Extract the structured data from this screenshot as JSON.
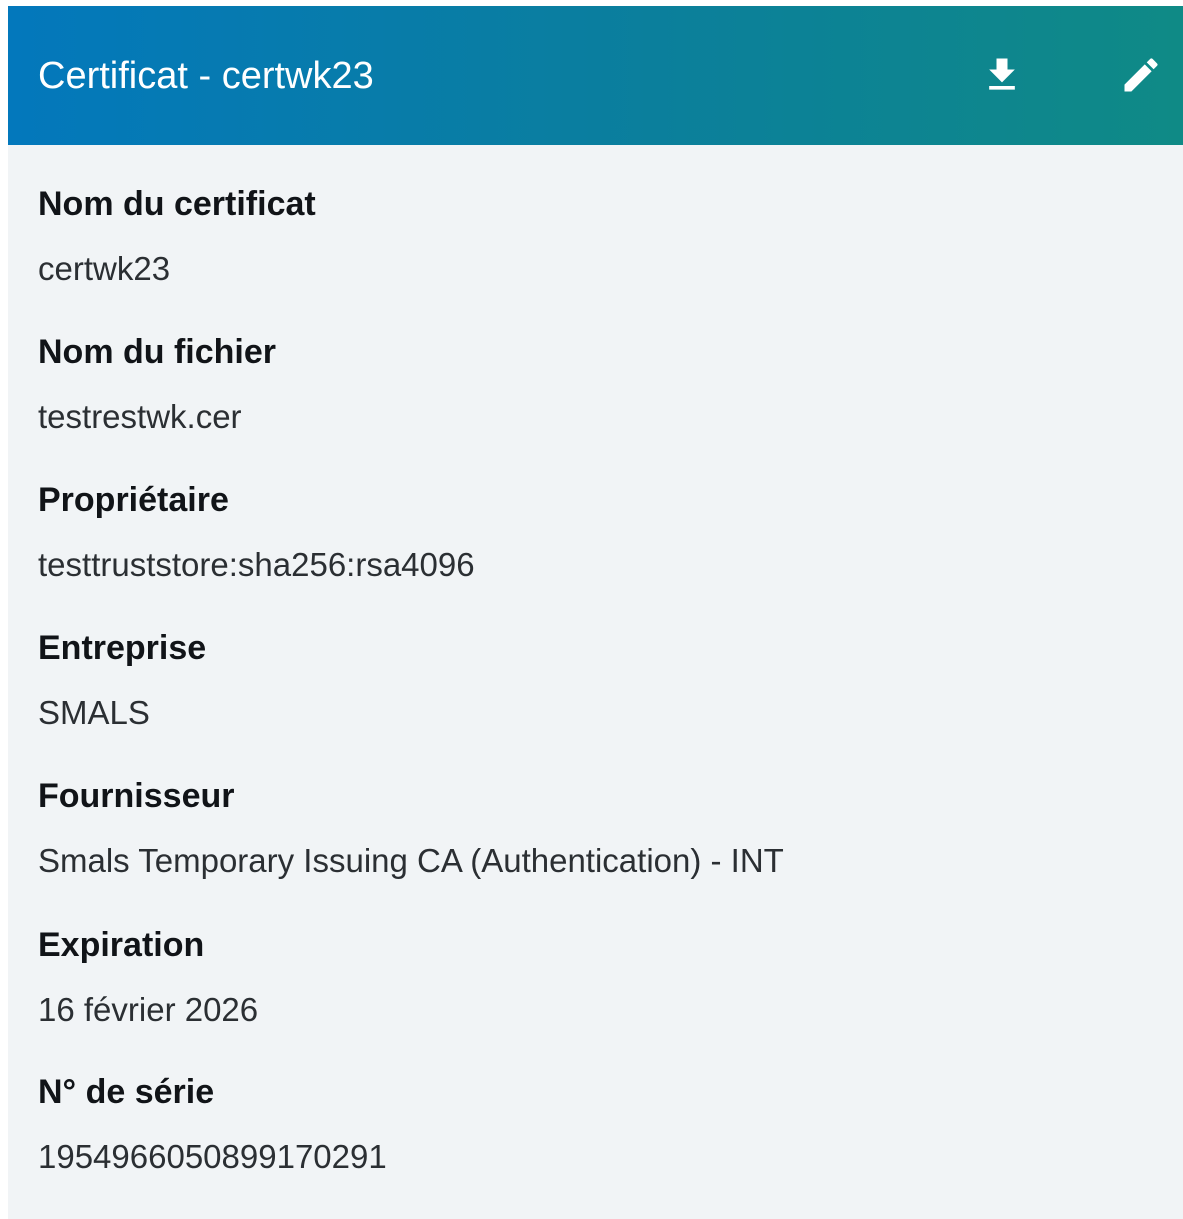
{
  "header": {
    "title": "Certificat - certwk23",
    "download_icon": "download-icon",
    "edit_icon": "pencil-icon",
    "gradient_start": "#0378bc",
    "gradient_end": "#0f8a86"
  },
  "fields": [
    {
      "label": "Nom du certificat",
      "value": "certwk23"
    },
    {
      "label": "Nom du fichier",
      "value": "testrestwk.cer"
    },
    {
      "label": "Propriétaire",
      "value": "testtruststore:sha256:rsa4096"
    },
    {
      "label": "Entreprise",
      "value": "SMALS"
    },
    {
      "label": "Fournisseur",
      "value": "Smals Temporary Issuing CA (Authentication) - INT"
    },
    {
      "label": "Expiration",
      "value": "16 février 2026"
    },
    {
      "label": "N° de série",
      "value": "1954966050899170291"
    }
  ]
}
